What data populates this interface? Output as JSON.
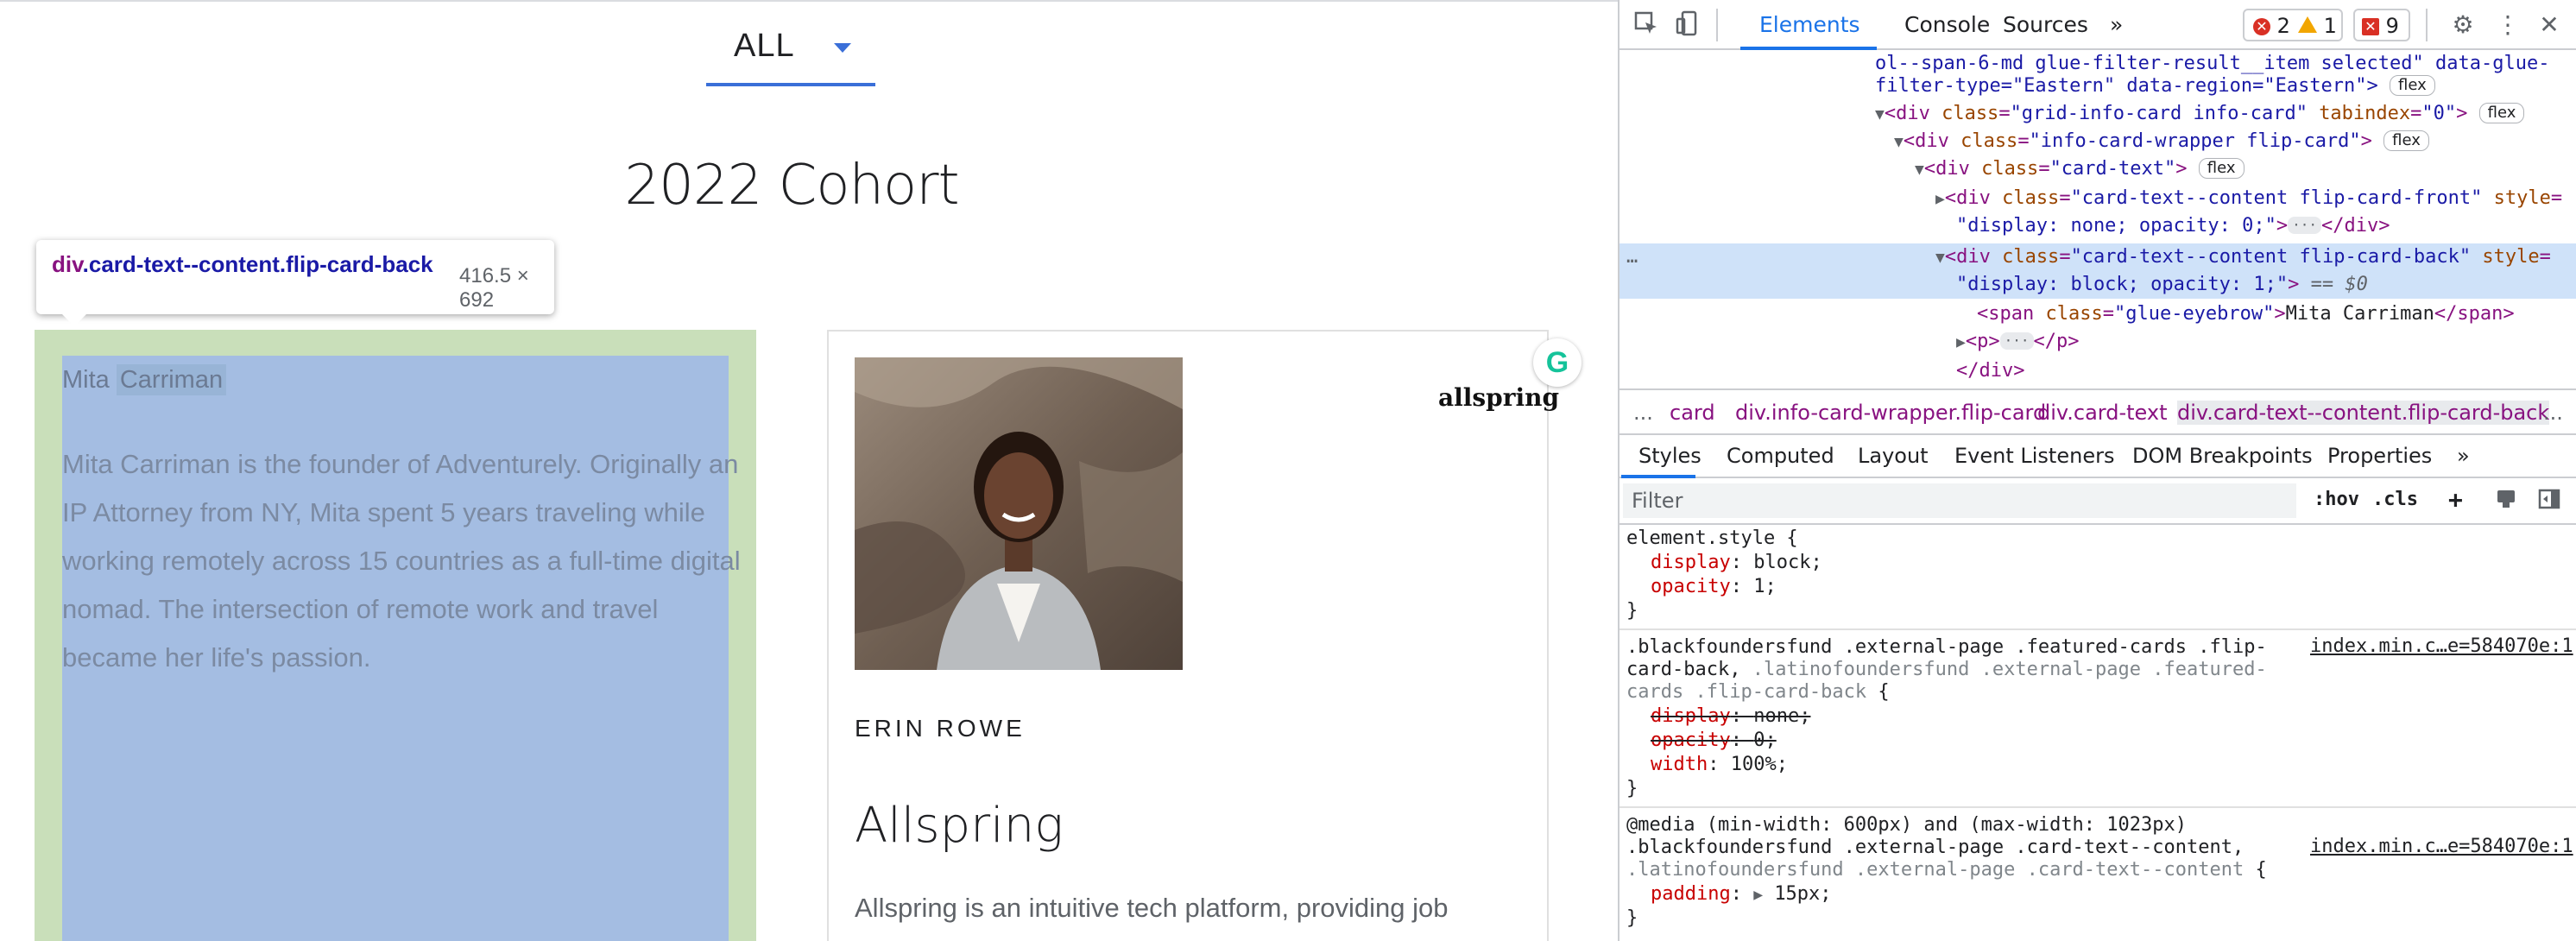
{
  "webpage": {
    "filter": {
      "value": "ALL"
    },
    "section_title": "2022 Cohort",
    "inspect_tooltip": {
      "tag": "div",
      "classes": ".card-text--content.flip-card-back",
      "dimensions": "416.5 × 692"
    },
    "card_one": {
      "eyebrow_first": "Mita ",
      "eyebrow_last": "Carriman",
      "bio": "Mita Carriman is the founder of Adventurely. Originally an IP Attorney from NY, Mita spent 5 years traveling while working remotely across 15 countries as a full-time digital nomad. The intersection of remote work and travel became her life's passion."
    },
    "card_two": {
      "logo": "allspring",
      "person": "ERIN ROWE",
      "company": "Allspring",
      "description": "Allspring is an intuitive tech platform, providing job"
    },
    "grammarly_icon": "G"
  },
  "devtools": {
    "tabs": [
      "Elements",
      "Console",
      "Sources",
      "»"
    ],
    "badges": {
      "errors": "2",
      "warnings": "1",
      "issues": "9"
    },
    "dom": {
      "line1": "ol--span-6-md glue-filter-result__item selected\" data-glue-",
      "line2": "filter-type=\"Eastern\" data-region=\"Eastern\">",
      "flex": "flex",
      "equals_dollar0": " == $0",
      "eyebrow_text": "Mita Carriman"
    },
    "breadcrumb": [
      "...",
      "card",
      "div.info-card-wrapper.flip-card",
      "div.card-text",
      "div.card-text--content.flip-card-back",
      "..."
    ],
    "styles_tabs": [
      "Styles",
      "Computed",
      "Layout",
      "Event Listeners",
      "DOM Breakpoints",
      "Properties",
      "»"
    ],
    "filter_placeholder": "Filter",
    "filter_buttons": {
      "hov": ":hov",
      "cls": ".cls",
      "plus": "+"
    },
    "rules": {
      "element_style": "element.style {",
      "display_name": "display",
      "display_block": "block;",
      "opacity_name": "opacity",
      "opacity_one": "1;",
      "close": "}",
      "rule2_sel_a": ".blackfoundersfund .external-page .featured-cards .flip-",
      "rule2_sel_b": "card-back,",
      "rule2_sel_b_dim": " .latinofoundersfund .external-page .featured-",
      "rule2_sel_c_dim": "cards .flip-card-back",
      "rule2_sel_c_end": " {",
      "display_none": "none;",
      "opacity_zero": "0;",
      "width_name": "width",
      "width_val": "100%;",
      "source": "index.min.c…e=584070e:1",
      "media": "@media (min-width: 600px) and (max-width: 1023px)",
      "rule3_sel_a": ".blackfoundersfund .external-page .card-text--content,",
      "rule3_sel_b_dim": ".latinofoundersfund .external-page .card-text--content",
      "rule3_sel_b_end": " {",
      "padding_name": "padding",
      "padding_val": "15px;"
    }
  },
  "colors": {
    "accent": "#1a73e8",
    "highlight_margin": "#c9dfba",
    "highlight_content": "#a4bde2",
    "dom_selected": "#cfe2f9"
  }
}
